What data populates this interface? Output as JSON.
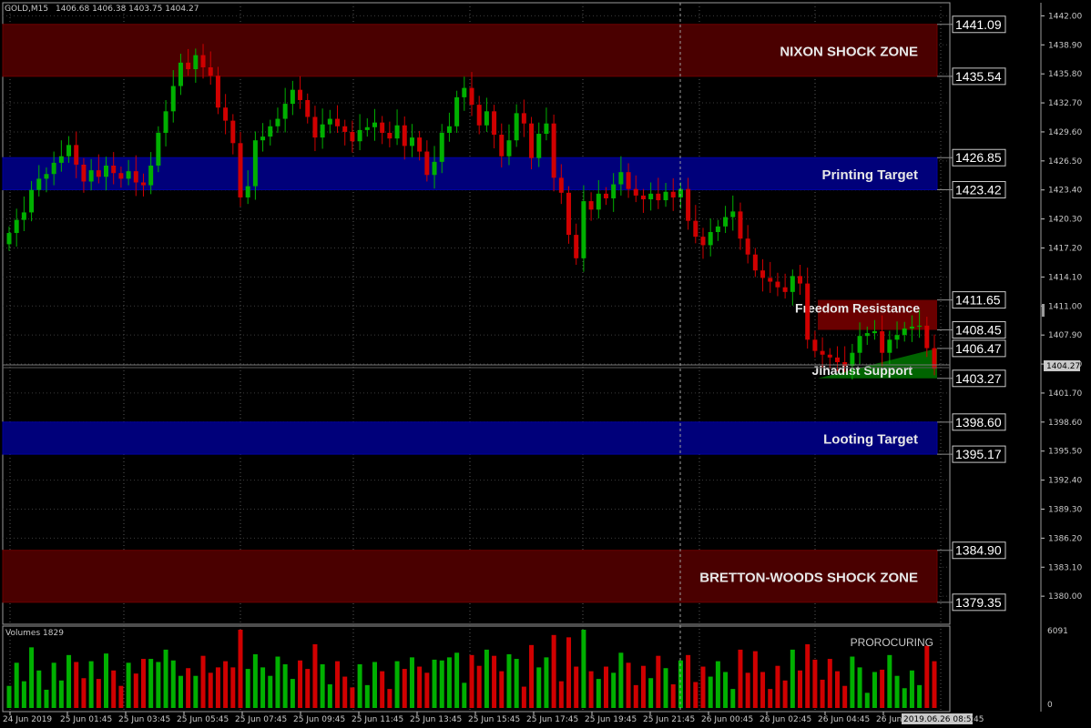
{
  "header": {
    "symbol": "GOLD,M15",
    "ohlc": "1406.68 1406.38 1403.75 1404.27"
  },
  "current_price": "1404.27",
  "price_axis": {
    "min": 1377.0,
    "max": 1443.4,
    "ticks": [
      "1442.00",
      "1438.90",
      "1435.80",
      "1432.70",
      "1429.60",
      "1426.50",
      "1423.40",
      "1420.30",
      "1417.20",
      "1414.10",
      "1411.00",
      "1407.90",
      "1404.80",
      "1401.70",
      "1398.60",
      "1395.50",
      "1392.40",
      "1389.30",
      "1386.20",
      "1383.10",
      "1380.00"
    ]
  },
  "zones": [
    {
      "label": "NIXON SHOCK ZONE",
      "top": 1441.09,
      "bottom": 1435.54,
      "color": "#4a0000",
      "edge": "#6e0000",
      "tag_top": "1441.09",
      "tag_bottom": "1435.54"
    },
    {
      "label": "Printing Target",
      "top": 1426.85,
      "bottom": 1423.42,
      "color": "#00007a",
      "edge": "#0000a0",
      "tag_top": "1426.85",
      "tag_bottom": "1423.42"
    },
    {
      "label": "Looting Target",
      "top": 1398.6,
      "bottom": 1395.17,
      "color": "#00007a",
      "edge": "#0000a0",
      "tag_top": "1398.60",
      "tag_bottom": "1395.17"
    },
    {
      "label": "BRETTON-WOODS SHOCK ZONE",
      "top": 1384.9,
      "bottom": 1379.35,
      "color": "#4a0000",
      "edge": "#6e0000",
      "tag_top": "1384.90",
      "tag_bottom": "1379.35"
    }
  ],
  "small_zones": [
    {
      "label": "Freedom Resistance",
      "top": 1411.65,
      "bottom": 1408.45,
      "color": "#6a0000",
      "tag_top": "1411.65",
      "tag_bottom": "1408.45"
    },
    {
      "label": "Jihadist Support",
      "top": 1406.47,
      "bottom": 1403.27,
      "color": "#006400",
      "tag_top": "1406.47",
      "tag_bottom": "1403.27"
    }
  ],
  "volume_panel": {
    "label": "Volumes 1829",
    "max_label": "6091",
    "zero_label": "0",
    "max": 6091,
    "note": "PROROCURING"
  },
  "time_axis": {
    "labels": [
      "24 Jun 2019",
      "25 Jun 01:45",
      "25 Jun 03:45",
      "25 Jun 05:45",
      "25 Jun 07:45",
      "25 Jun 09:45",
      "25 Jun 11:45",
      "25 Jun 13:45",
      "25 Jun 15:45",
      "25 Jun 17:45",
      "25 Jun 19:45",
      "25 Jun 21:45",
      "26 Jun 00:45",
      "26 Jun 02:45",
      "26 Jun 04:45",
      "26 Jun"
    ],
    "cursor_label": "2019.06.26 08:53",
    "tail": "45"
  },
  "colors": {
    "bull": "#00b000",
    "bear": "#d00000",
    "grid": "#8c8c8c",
    "axis_text": "#c8c8c8",
    "cursor_line": "#a0a0a0"
  },
  "chart_data": {
    "type": "candlestick",
    "symbol": "GOLD",
    "timeframe": "M15",
    "closes": [
      1418.8,
      1420.2,
      1421.0,
      1423.4,
      1424.6,
      1425.1,
      1426.3,
      1427.0,
      1428.2,
      1426.1,
      1424.3,
      1425.5,
      1424.8,
      1426.0,
      1425.2,
      1424.6,
      1425.4,
      1424.2,
      1423.9,
      1426.0,
      1429.5,
      1431.8,
      1434.5,
      1437.0,
      1436.3,
      1437.8,
      1436.5,
      1435.6,
      1432.2,
      1430.8,
      1428.4,
      1422.6,
      1423.8,
      1428.7,
      1429.1,
      1430.2,
      1431.0,
      1432.6,
      1434.1,
      1433.0,
      1431.2,
      1429.0,
      1430.4,
      1431.0,
      1430.2,
      1429.6,
      1428.6,
      1429.8,
      1430.1,
      1430.6,
      1429.5,
      1428.9,
      1430.3,
      1428.1,
      1429.0,
      1427.5,
      1425.0,
      1426.4,
      1429.5,
      1430.2,
      1433.3,
      1434.3,
      1432.5,
      1430.3,
      1431.8,
      1429.3,
      1427.0,
      1428.7,
      1431.6,
      1430.5,
      1426.8,
      1429.4,
      1430.5,
      1424.7,
      1423.1,
      1418.6,
      1416.1,
      1422.2,
      1421.3,
      1423.0,
      1422.5,
      1424.0,
      1425.3,
      1423.5,
      1422.8,
      1422.4,
      1423.0,
      1422.3,
      1423.2,
      1422.6,
      1423.5,
      1420.1,
      1418.4,
      1417.5,
      1418.9,
      1419.5,
      1420.5,
      1421.1,
      1418.2,
      1416.5,
      1414.8,
      1414.0,
      1413.6,
      1413.0,
      1412.5,
      1414.2,
      1413.4,
      1407.4,
      1406.2,
      1405.8,
      1405.5,
      1405.0,
      1404.6,
      1406.0,
      1407.8,
      1408.1,
      1408.3,
      1406.0,
      1407.4,
      1407.9,
      1408.6,
      1408.8,
      1408.9,
      1406.5,
      1404.3
    ]
  }
}
